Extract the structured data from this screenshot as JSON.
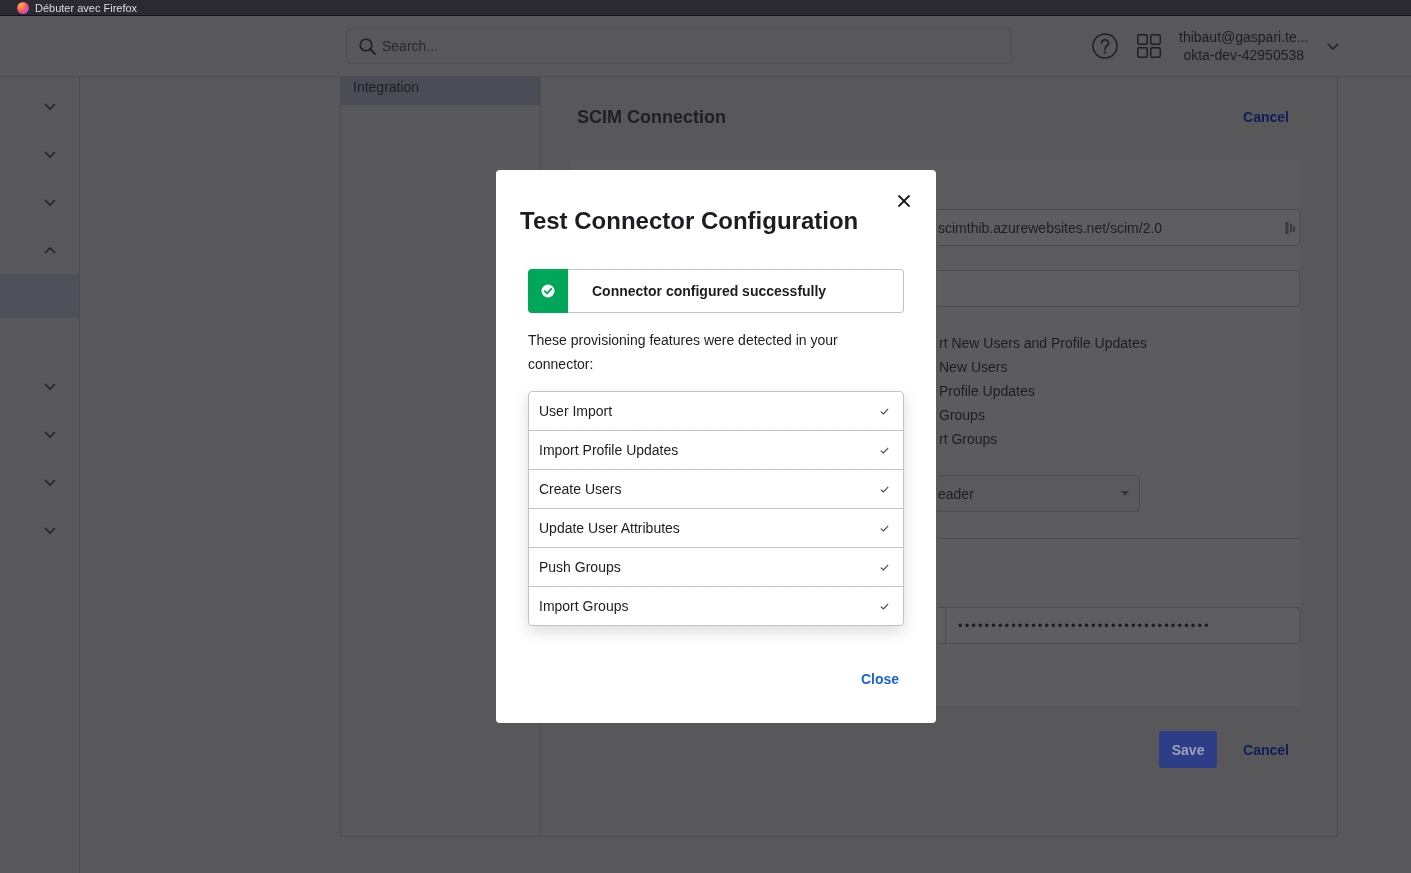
{
  "browser_bar": {
    "bookmarks": [
      {
        "label": "Débuter avec Firefox"
      }
    ]
  },
  "header": {
    "search": {
      "placeholder": "Search..."
    },
    "user": {
      "email": "thibaut@gaspari.te...",
      "org": "okta-dev-42950538"
    }
  },
  "sidebar": {
    "sections": [
      {
        "expanded": false
      },
      {
        "expanded": false
      },
      {
        "expanded": false
      },
      {
        "expanded": true,
        "children": [
          {
            "selected": true
          }
        ]
      },
      {
        "expanded": false
      },
      {
        "expanded": false
      },
      {
        "expanded": false
      },
      {
        "expanded": false
      }
    ]
  },
  "settings_nav": {
    "items": [
      {
        "label": "Integration",
        "selected": true
      }
    ]
  },
  "scim_connection": {
    "title": "SCIM Connection",
    "cancel_link": "Cancel",
    "form_rows": [
      {
        "kind": "text_field",
        "value": "scimthib.azurewebsites.net/scim/2.0"
      },
      {
        "kind": "text_field"
      },
      {
        "kind": "checkbox_list",
        "options": [
          {
            "label": "rt New Users and Profile Updates"
          },
          {
            "label": "New Users"
          },
          {
            "label": "Profile Updates"
          },
          {
            "label": "Groups"
          },
          {
            "label": "rt Groups"
          }
        ]
      },
      {
        "kind": "select",
        "value": "eader"
      },
      {
        "kind": "divider"
      },
      {
        "kind": "password_field",
        "value": "••••••••••••••••••••••••••••••••••••••"
      }
    ],
    "save_button": "Save",
    "cancel_button": "Cancel"
  },
  "dialog": {
    "title": "Test Connector Configuration",
    "status": {
      "kind": "success",
      "message": "Connector configured successfully"
    },
    "intro": "These provisioning features were detected in your connector:",
    "features": [
      {
        "label": "User Import",
        "checked": true
      },
      {
        "label": "Import Profile Updates",
        "checked": true
      },
      {
        "label": "Create Users",
        "checked": true
      },
      {
        "label": "Update User Attributes",
        "checked": true
      },
      {
        "label": "Push Groups",
        "checked": true
      },
      {
        "label": "Import Groups",
        "checked": true
      }
    ],
    "close_link": "Close"
  }
}
